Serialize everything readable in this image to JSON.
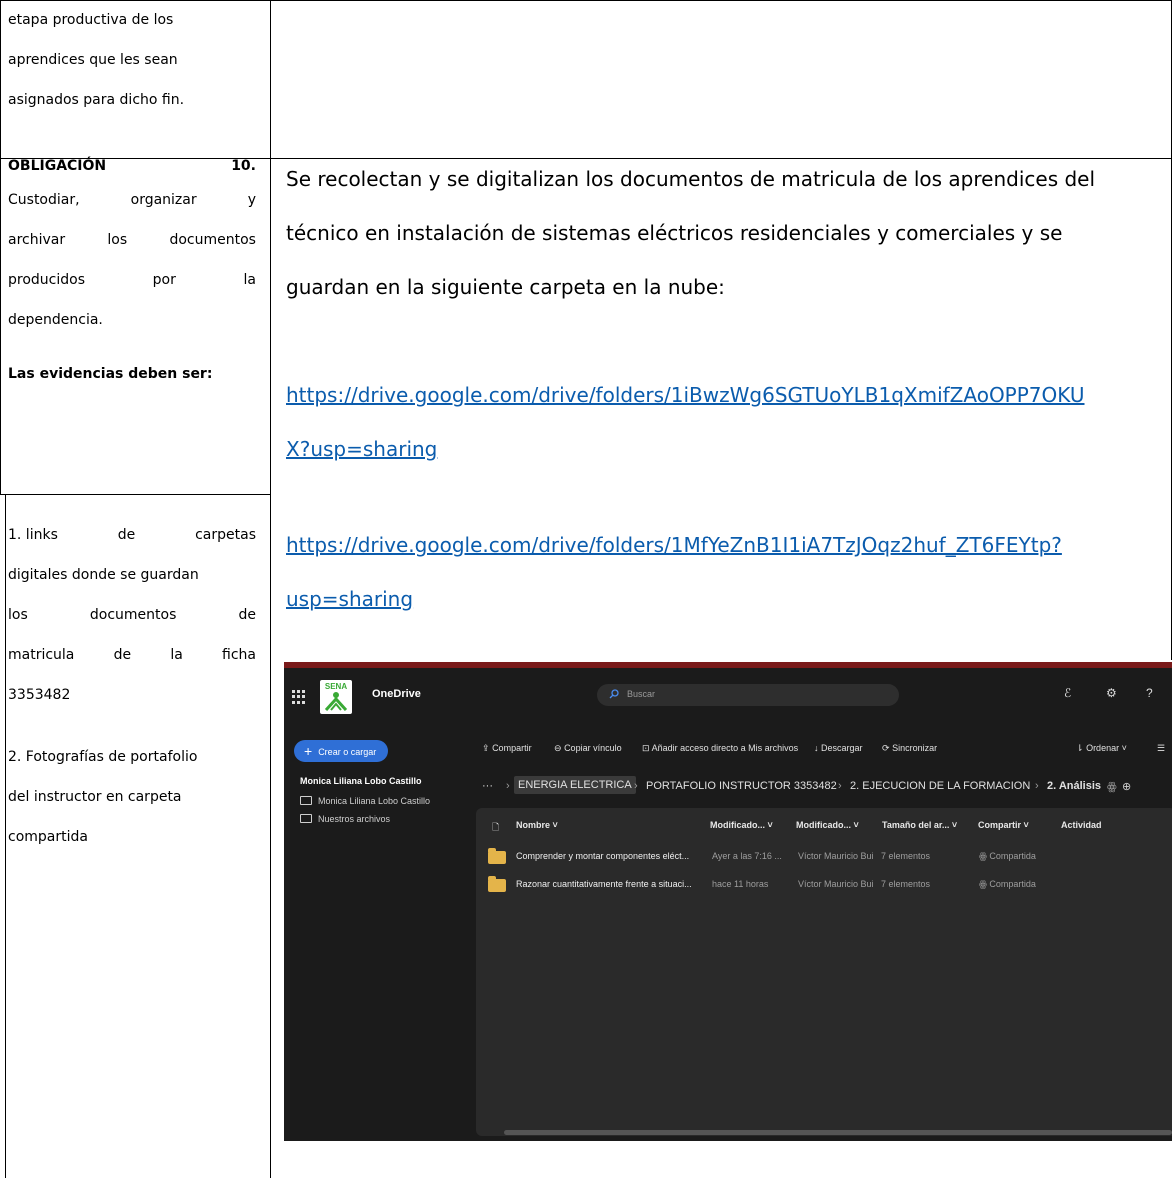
{
  "table": {
    "top_left_lines": [
      "etapa productiva de los",
      "aprendices que les sean",
      "asignados para dicho fin."
    ],
    "obligation_heading_left": "OBLIGACIÓN",
    "obligation_heading_right": "10.",
    "obligation_desc_lines": [
      [
        "Custodiar,",
        "organizar",
        "y"
      ],
      [
        "archivar",
        "los",
        "documentos"
      ],
      [
        "producidos",
        "por",
        "la"
      ],
      [
        "dependencia."
      ]
    ],
    "evidences_heading": "Las evidencias deben ser:",
    "evidence_1_lines": [
      [
        "1. links",
        "de",
        "carpetas"
      ],
      [
        "digitales donde se guardan"
      ],
      [
        "los",
        "documentos",
        "de"
      ],
      [
        "matricula",
        "de",
        "la",
        "ficha"
      ],
      [
        "3353482"
      ]
    ],
    "evidence_2_lines": [
      [
        "2. Fotografías de portafolio"
      ],
      [
        "del instructor en carpeta"
      ],
      [
        "compartida"
      ]
    ],
    "description_lines": [
      "Se recolectan y se digitalizan los documentos de matricula de los aprendices del",
      "técnico en instalación de sistemas eléctricos residenciales y comerciales y se",
      "guardan en la siguiente carpeta en la nube:"
    ],
    "link_1_lines": [
      "https://drive.google.com/drive/folders/1iBwzWg6SGTUoYLB1qXmifZAoOPP7OKU",
      "X?usp=sharing"
    ],
    "link_2_lines": [
      "https://drive.google.com/drive/folders/1MfYeZnB1I1iA7TzJOqz2huf_ZT6FEYtp?",
      "usp=sharing"
    ]
  },
  "onedrive": {
    "logo_text": "SENA",
    "app_name": "OneDrive",
    "search_placeholder": "Buscar",
    "top_right_icons": [
      "people-icon",
      "settings-icon",
      "help-icon"
    ],
    "top_right_glyphs": [
      "ℰ",
      "⚙",
      "?"
    ],
    "create_button": "Crear o cargar",
    "user_name": "Monica Liliana Lobo Castillo",
    "sidebar_items": [
      {
        "label": "Monica Liliana Lobo Castillo",
        "icon": "folder-icon"
      },
      {
        "label": "Nuestros archivos",
        "icon": "shared-folder-icon"
      }
    ],
    "commands": [
      {
        "label": "Compartir",
        "glyph": "⇪"
      },
      {
        "label": "Copiar vínculo",
        "glyph": "⊖"
      },
      {
        "label": "Añadir acceso directo a Mis archivos",
        "glyph": "⊡"
      },
      {
        "label": "Descargar",
        "glyph": "↓"
      },
      {
        "label": "Sincronizar",
        "glyph": "⟳"
      }
    ],
    "sort_label": "Ordenar",
    "sort_glyph": "⇂",
    "breadcrumb": {
      "ellipsis": "···",
      "separator": "›",
      "items": [
        "ENERGIA ELECTRICA",
        "PORTAFOLIO INSTRUCTOR 3353482",
        "2. EJECUCION DE LA FORMACION",
        "2. Análisis"
      ]
    },
    "columns": [
      "Nombre",
      "Modificado...",
      "Modificado...",
      "Tamaño del ar...",
      "Compartir",
      "Actividad"
    ],
    "rows": [
      {
        "name": "Comprender y montar componentes eléct...",
        "modified": "Ayer a las 7:16 ...",
        "modified_by": "Víctor Mauricio Bui",
        "size": "7 elementos",
        "sharing": "Compartida"
      },
      {
        "name": "Razonar cuantitativamente frente a situaci...",
        "modified": "hace 11 horas",
        "modified_by": "Víctor Mauricio Bui",
        "size": "7 elementos",
        "sharing": "Compartida"
      }
    ],
    "colors": {
      "background": "#1f1f1f",
      "panel": "#2a2a2a",
      "accent": "#2f6fd6",
      "folder": "#e4b44a",
      "red_border": "#7a1a1a"
    }
  }
}
